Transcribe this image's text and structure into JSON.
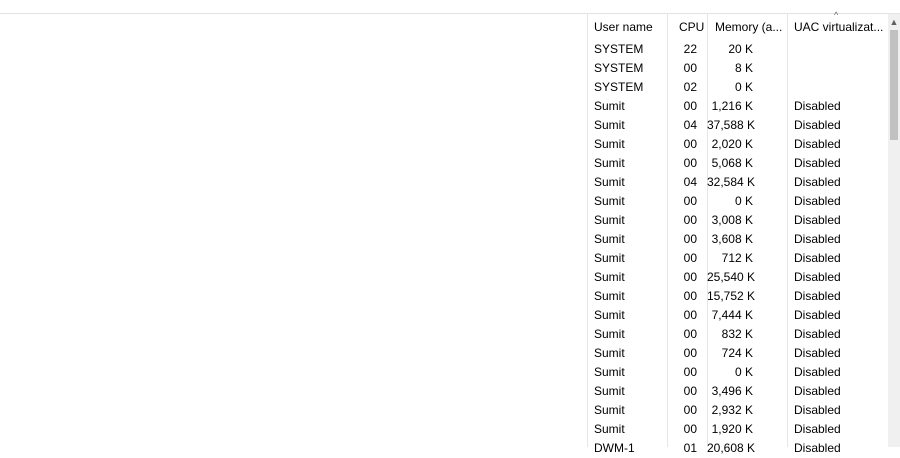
{
  "columns": {
    "user": "User name",
    "cpu": "CPU",
    "memory": "Memory (a...",
    "uac": "UAC virtualizat..."
  },
  "rows": [
    {
      "user": "SYSTEM",
      "cpu": "22",
      "memory": "20 K",
      "uac": ""
    },
    {
      "user": "SYSTEM",
      "cpu": "00",
      "memory": "8 K",
      "uac": ""
    },
    {
      "user": "SYSTEM",
      "cpu": "02",
      "memory": "0 K",
      "uac": ""
    },
    {
      "user": "Sumit",
      "cpu": "00",
      "memory": "1,216 K",
      "uac": "Disabled"
    },
    {
      "user": "Sumit",
      "cpu": "04",
      "memory": "37,588 K",
      "uac": "Disabled"
    },
    {
      "user": "Sumit",
      "cpu": "00",
      "memory": "2,020 K",
      "uac": "Disabled"
    },
    {
      "user": "Sumit",
      "cpu": "00",
      "memory": "5,068 K",
      "uac": "Disabled"
    },
    {
      "user": "Sumit",
      "cpu": "04",
      "memory": "32,584 K",
      "uac": "Disabled"
    },
    {
      "user": "Sumit",
      "cpu": "00",
      "memory": "0 K",
      "uac": "Disabled"
    },
    {
      "user": "Sumit",
      "cpu": "00",
      "memory": "3,008 K",
      "uac": "Disabled"
    },
    {
      "user": "Sumit",
      "cpu": "00",
      "memory": "3,608 K",
      "uac": "Disabled"
    },
    {
      "user": "Sumit",
      "cpu": "00",
      "memory": "712 K",
      "uac": "Disabled"
    },
    {
      "user": "Sumit",
      "cpu": "00",
      "memory": "25,540 K",
      "uac": "Disabled"
    },
    {
      "user": "Sumit",
      "cpu": "00",
      "memory": "15,752 K",
      "uac": "Disabled"
    },
    {
      "user": "Sumit",
      "cpu": "00",
      "memory": "7,444 K",
      "uac": "Disabled"
    },
    {
      "user": "Sumit",
      "cpu": "00",
      "memory": "832 K",
      "uac": "Disabled"
    },
    {
      "user": "Sumit",
      "cpu": "00",
      "memory": "724 K",
      "uac": "Disabled"
    },
    {
      "user": "Sumit",
      "cpu": "00",
      "memory": "0 K",
      "uac": "Disabled"
    },
    {
      "user": "Sumit",
      "cpu": "00",
      "memory": "3,496 K",
      "uac": "Disabled"
    },
    {
      "user": "Sumit",
      "cpu": "00",
      "memory": "2,932 K",
      "uac": "Disabled"
    },
    {
      "user": "Sumit",
      "cpu": "00",
      "memory": "1,920 K",
      "uac": "Disabled"
    },
    {
      "user": "DWM-1",
      "cpu": "01",
      "memory": "20,608 K",
      "uac": "Disabled"
    }
  ],
  "icons": {
    "sort": "sort-ascending-icon",
    "scroll_up": "scroll-up-arrow-icon"
  },
  "colors": {
    "separator": "#e6e6e6",
    "scrollbar_track": "#f0f0f0",
    "scrollbar_thumb": "#c1c1c1"
  }
}
